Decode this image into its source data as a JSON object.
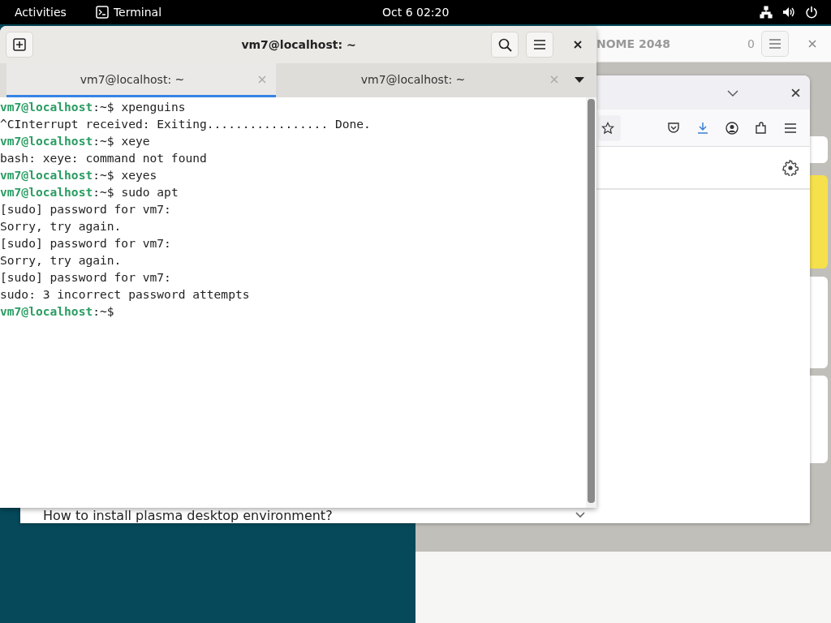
{
  "top_bar": {
    "activities": "Activities",
    "app_name": "Terminal",
    "clock": "Oct 6  02:20"
  },
  "game_window": {
    "title": "NOME 2048",
    "score": "0"
  },
  "browser": {
    "faq_item": "How to install plasma desktop environment?"
  },
  "terminal": {
    "title": "vm7@localhost: ~",
    "tabs": [
      {
        "label": "vm7@localhost: ~",
        "selected": true
      },
      {
        "label": "vm7@localhost: ~",
        "selected": false
      }
    ],
    "lines": [
      {
        "kind": "prompt",
        "host": "vm7@localhost",
        "path": ":~$ ",
        "command": "xpenguins"
      },
      {
        "kind": "output",
        "text": "^CInterrupt received: Exiting................. Done."
      },
      {
        "kind": "prompt",
        "host": "vm7@localhost",
        "path": ":~$ ",
        "command": "xeye"
      },
      {
        "kind": "output",
        "text": "bash: xeye: command not found"
      },
      {
        "kind": "prompt",
        "host": "vm7@localhost",
        "path": ":~$ ",
        "command": "xeyes"
      },
      {
        "kind": "prompt",
        "host": "vm7@localhost",
        "path": ":~$ ",
        "command": "sudo apt"
      },
      {
        "kind": "output",
        "text": "[sudo] password for vm7:"
      },
      {
        "kind": "output",
        "text": "Sorry, try again."
      },
      {
        "kind": "output",
        "text": "[sudo] password for vm7:"
      },
      {
        "kind": "output",
        "text": "Sorry, try again."
      },
      {
        "kind": "output",
        "text": "[sudo] password for vm7:"
      },
      {
        "kind": "output",
        "text": "sudo: 3 incorrect password attempts"
      },
      {
        "kind": "prompt",
        "host": "vm7@localhost",
        "path": ":~$"
      }
    ]
  }
}
